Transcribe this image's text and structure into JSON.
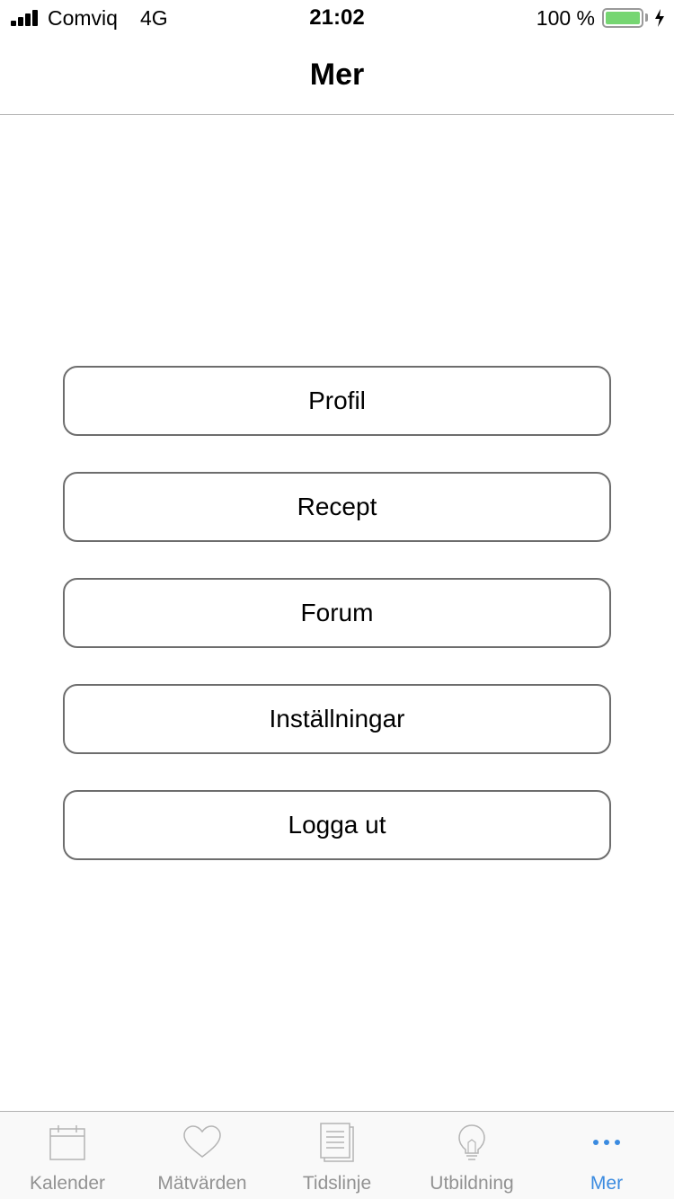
{
  "status_bar": {
    "carrier": "Comviq",
    "network": "4G",
    "time": "21:02",
    "battery_percent": "100 %",
    "battery_level": 1.0,
    "battery_color": "#76d672",
    "signal_bars": 4
  },
  "nav": {
    "title": "Mer"
  },
  "menu": {
    "buttons": [
      {
        "label": "Profil"
      },
      {
        "label": "Recept"
      },
      {
        "label": "Forum"
      },
      {
        "label": "Inställningar"
      },
      {
        "label": "Logga ut"
      }
    ]
  },
  "tab_bar": {
    "active_color": "#3b8be0",
    "inactive_color": "#929292",
    "tabs": [
      {
        "label": "Kalender",
        "icon": "calendar-icon",
        "active": false
      },
      {
        "label": "Mätvärden",
        "icon": "heart-icon",
        "active": false
      },
      {
        "label": "Tidslinje",
        "icon": "document-icon",
        "active": false
      },
      {
        "label": "Utbildning",
        "icon": "lightbulb-icon",
        "active": false
      },
      {
        "label": "Mer",
        "icon": "more-icon",
        "active": true
      }
    ]
  }
}
